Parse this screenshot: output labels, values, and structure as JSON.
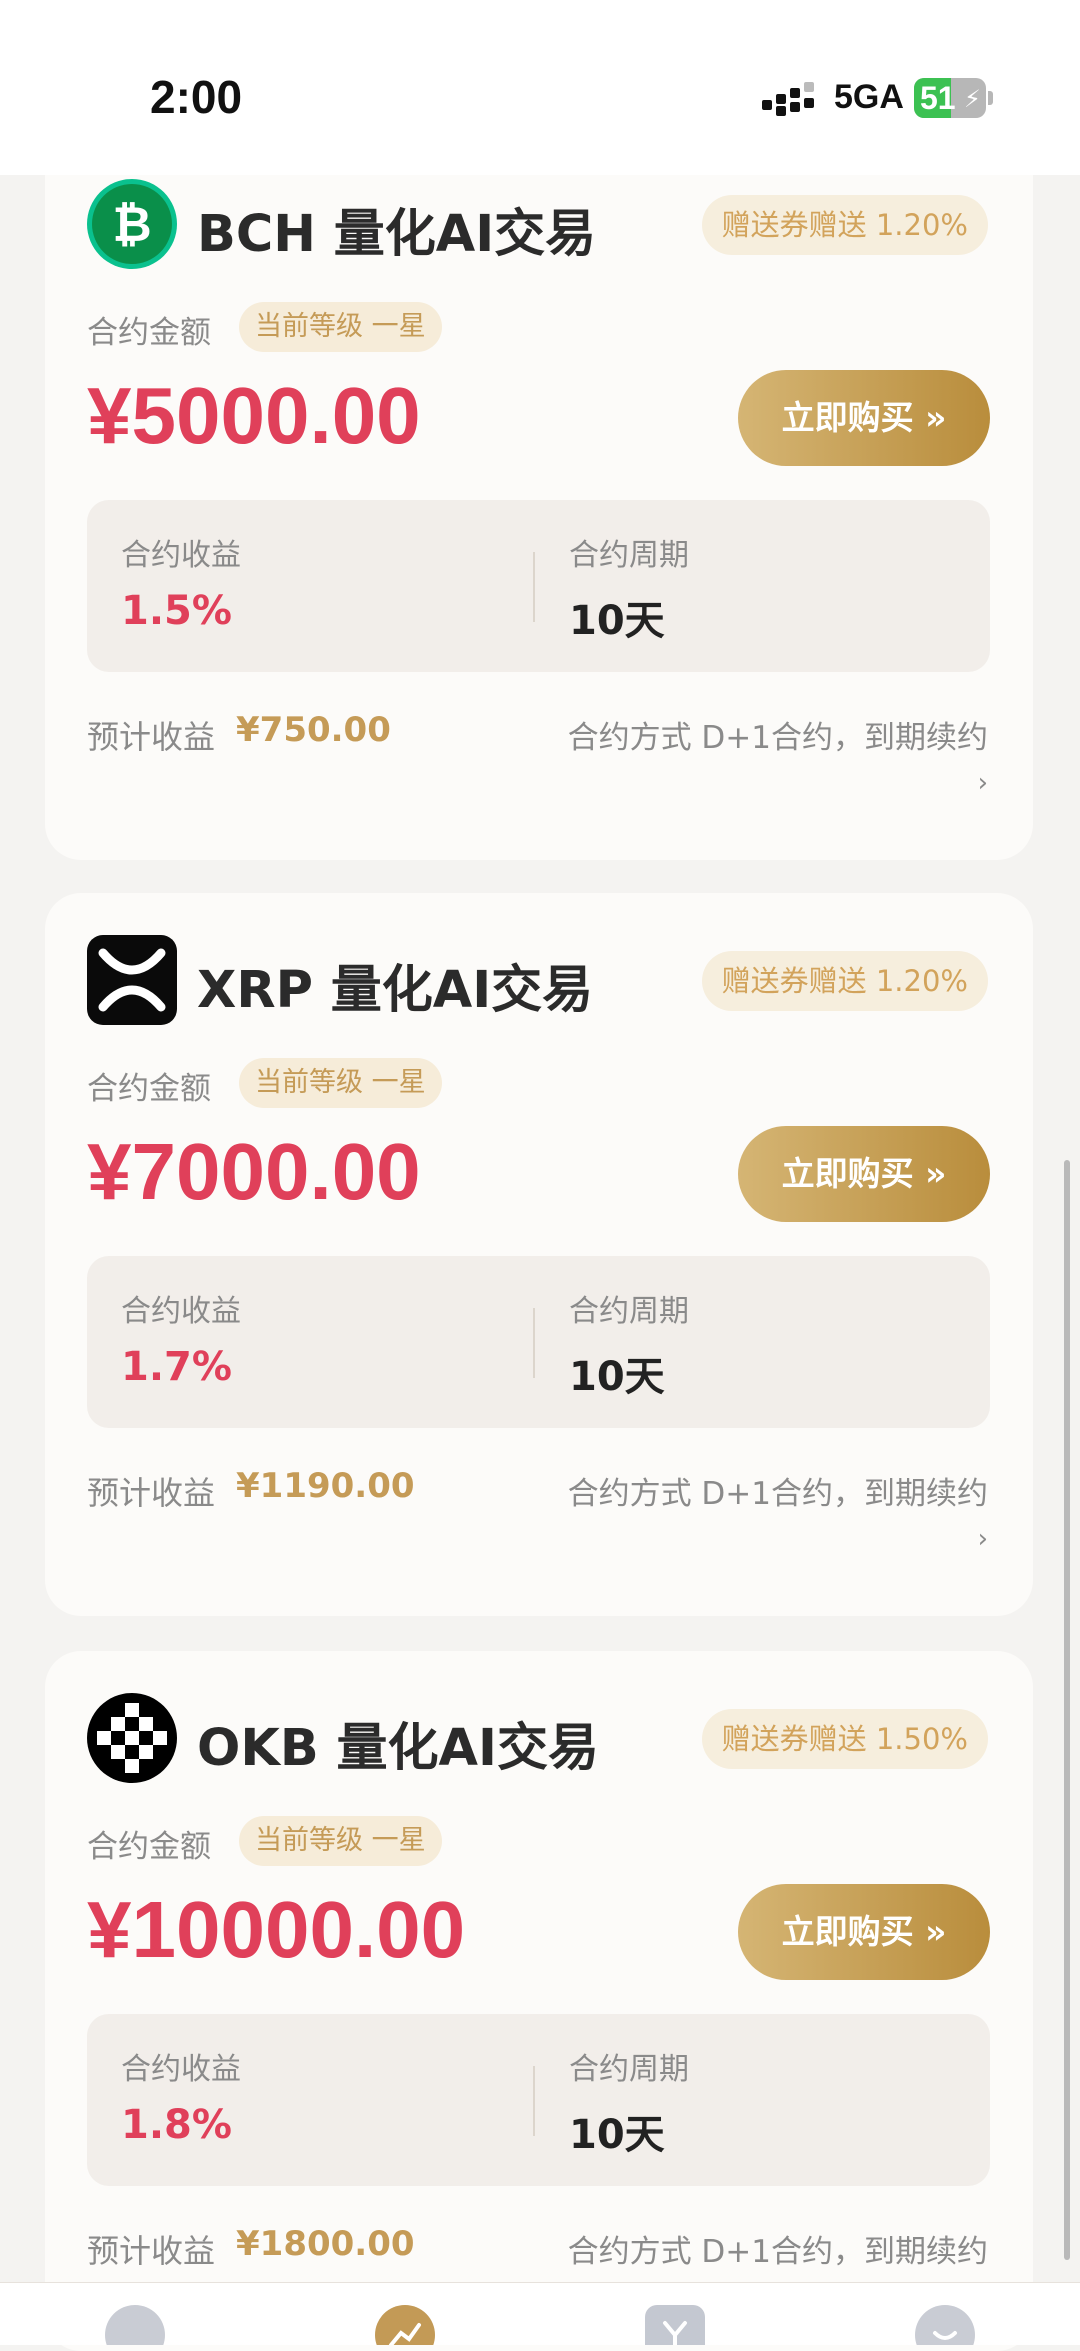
{
  "status_bar": {
    "time": "2:00",
    "network": "5GA",
    "battery_level": "51",
    "battery_fraction": 0.51,
    "battery_color": "#3cc152"
  },
  "cards": [
    {
      "logo_icon": "bitcoin-cash-icon",
      "title": "BCH 量化AI交易",
      "bonus": "赠送券赠送 1.20%",
      "amount_label": "合约金额",
      "level": "当前等级 一星",
      "price": "¥5000.00",
      "buy_label": "立即购买 »",
      "yield_label": "合约收益",
      "yield_value": "1.5%",
      "period_label": "合约周期",
      "period_value": "10天",
      "expected_label": "预计收益",
      "expected_value": "¥750.00",
      "method": "合约方式 D+1合约，到期续约",
      "chevron": "›"
    },
    {
      "logo_icon": "xrp-icon",
      "title": "XRP 量化AI交易",
      "bonus": "赠送券赠送 1.20%",
      "amount_label": "合约金额",
      "level": "当前等级 一星",
      "price": "¥7000.00",
      "buy_label": "立即购买 »",
      "yield_label": "合约收益",
      "yield_value": "1.7%",
      "period_label": "合约周期",
      "period_value": "10天",
      "expected_label": "预计收益",
      "expected_value": "¥1190.00",
      "method": "合约方式 D+1合约，到期续约",
      "chevron": "›"
    },
    {
      "logo_icon": "okb-icon",
      "title": "OKB 量化AI交易",
      "bonus": "赠送券赠送 1.50%",
      "amount_label": "合约金额",
      "level": "当前等级 一星",
      "price": "¥10000.00",
      "buy_label": "立即购买 »",
      "yield_label": "合约收益",
      "yield_value": "1.8%",
      "period_label": "合约周期",
      "period_value": "10天",
      "expected_label": "预计收益",
      "expected_value": "¥1800.00",
      "method": "合约方式 D+1合约，到期续约"
    }
  ],
  "tabbar": {
    "icons": [
      "home-icon",
      "market-icon",
      "mining-icon",
      "profile-icon"
    ]
  },
  "colors": {
    "price_red": "#e0405a",
    "gold": "#c59b57",
    "button_gradient_start": "#d5b574",
    "button_gradient_end": "#b98d3c"
  }
}
